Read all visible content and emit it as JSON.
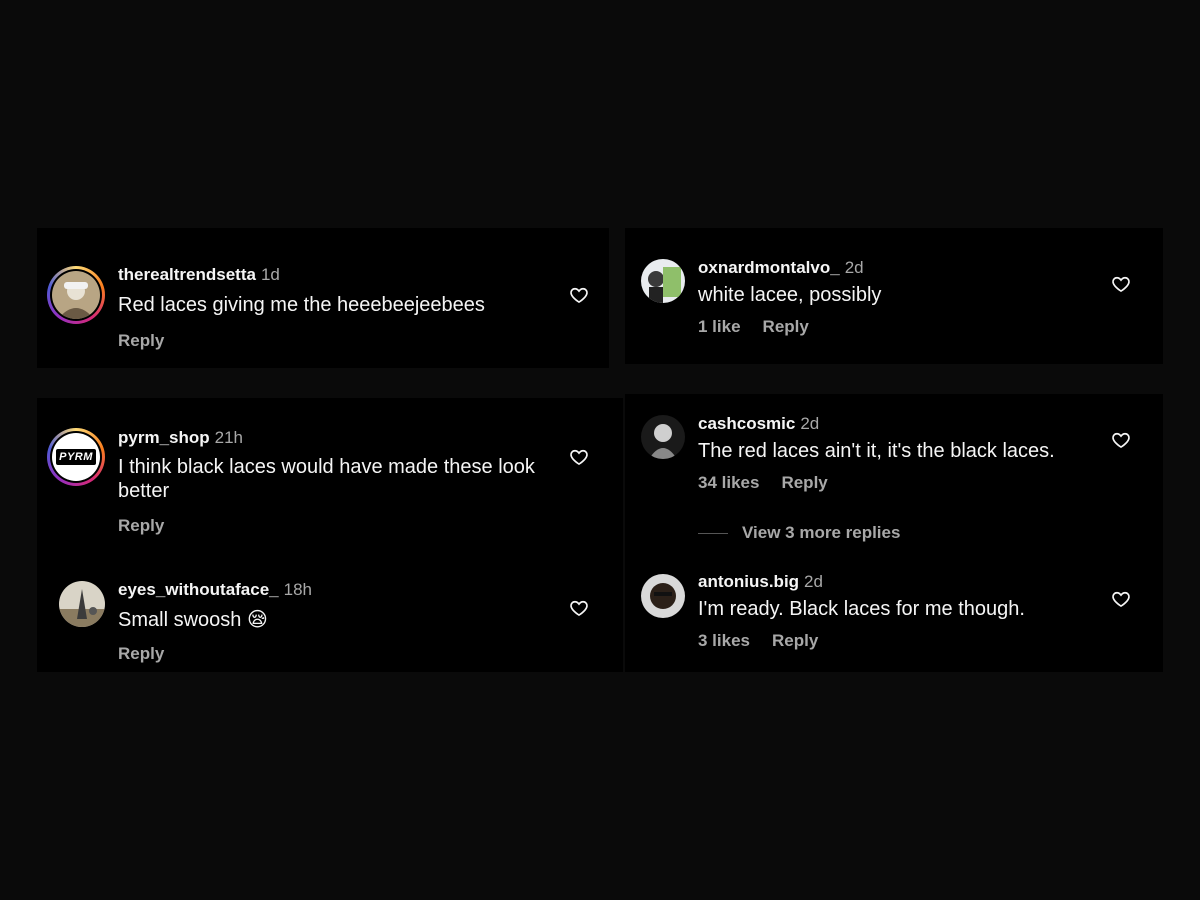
{
  "comments": [
    {
      "username": "therealtrendsetta",
      "time": "1d",
      "text": "Red laces giving me the heeebeejeebees",
      "likes": "",
      "reply": "Reply"
    },
    {
      "username": "oxnardmontalvo_",
      "time": "2d",
      "text": "white lacee, possibly",
      "likes": "1 like",
      "reply": "Reply"
    },
    {
      "username": "pyrm_shop",
      "time": "21h",
      "text": "I think black laces would have made these look better",
      "likes": "",
      "reply": "Reply",
      "avatar_text": "PYRM"
    },
    {
      "username": "eyes_withoutaface_",
      "time": "18h",
      "text": "Small swoosh",
      "emoji": "😪",
      "likes": "",
      "reply": "Reply"
    },
    {
      "username": "cashcosmic",
      "time": "2d",
      "text": "The red laces ain't it, it's the black laces.",
      "likes": "34 likes",
      "reply": "Reply"
    },
    {
      "username": "antonius.big",
      "time": "2d",
      "text": "I'm ready. Black laces for me though.",
      "likes": "3 likes",
      "reply": "Reply"
    }
  ],
  "view_more_replies": "View 3 more replies",
  "icons": {
    "like": "heart-outline-icon"
  },
  "colors": {
    "background": "#0a0a0a",
    "panel": "#000000",
    "secondary_text": "#a8a8a8",
    "primary_text": "#f5f5f5"
  }
}
